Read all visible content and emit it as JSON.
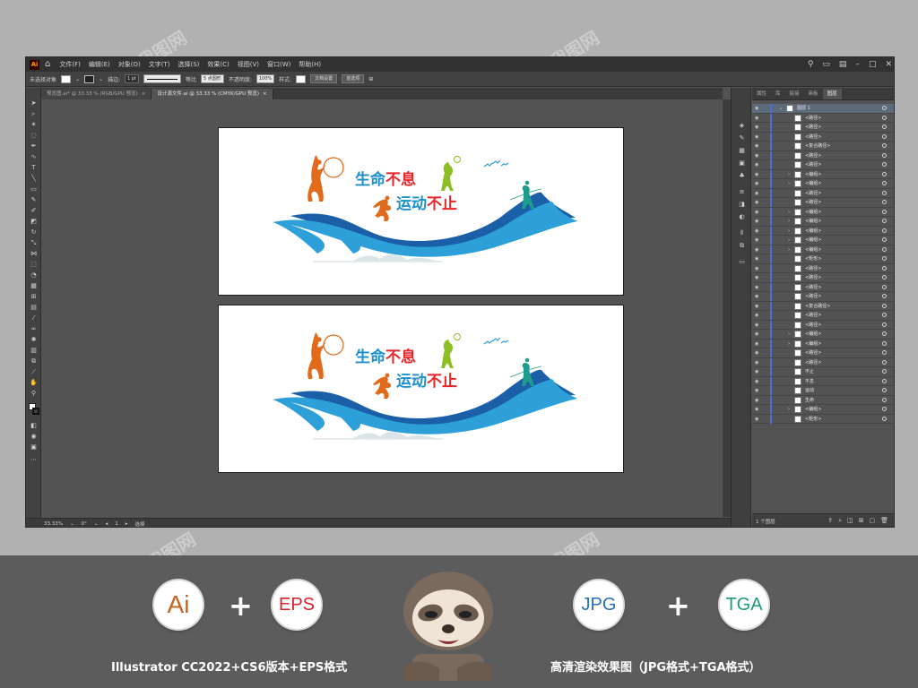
{
  "menubar": {
    "app_icon": "Ai",
    "items": [
      "文件(F)",
      "编辑(E)",
      "对象(O)",
      "文字(T)",
      "选择(S)",
      "效果(C)",
      "视图(V)",
      "窗口(W)",
      "帮助(H)"
    ]
  },
  "control_bar": {
    "selection_label": "未选择对象",
    "stroke_label": "描边:",
    "stroke_weight": "1 pt",
    "stroke_profile": "等比",
    "brush": "5 点圆形",
    "opacity_label": "不透明度:",
    "opacity_value": "100%",
    "style_label": "样式:",
    "doc_setup_button": "文档设置",
    "preferences_button": "首选项"
  },
  "doc_tabs": [
    {
      "label": "预览图.ai* @ 33.33 % (RGB/GPU 预览)",
      "active": false
    },
    {
      "label": "设计源文件.ai @ 33.33 % (CMYK/GPU 预览)",
      "active": true
    }
  ],
  "status_bar": {
    "zoom": "33.33%",
    "rotation": "0°",
    "artboard_number": "1",
    "mode": "选择"
  },
  "artwork": {
    "line1_a": "生命",
    "line1_b": "不息",
    "line2_a": "运动",
    "line2_b": "不止"
  },
  "layers_panel": {
    "tabs": [
      "属性",
      "库",
      "链接",
      "画板",
      "图层"
    ],
    "active_tab": "图层",
    "top_layer": "图层 1",
    "items": [
      "<路径>",
      "<路径>",
      "<路径>",
      "<复合路径>",
      "<路径>",
      "<路径>",
      "<编组>",
      "<编组>",
      "<路径>",
      "<路径>",
      "<编组>",
      "<编组>",
      "<编组>",
      "<编组>",
      "<编组>",
      "<矩形>",
      "<路径>",
      "<路径>",
      "<路径>",
      "<路径>",
      "<复合路径>",
      "<路径>",
      "<路径>",
      "<编组>",
      "<编组>",
      "<路径>",
      "<路径>",
      "不止",
      "不息",
      "运动",
      "生命",
      "<编组>",
      "<矩形>"
    ],
    "footer_count": "1 个图层"
  },
  "watermark_text": "我图网",
  "banner": {
    "badges": [
      {
        "label": "Ai",
        "color": "#c8641e"
      },
      {
        "label": "EPS",
        "color": "#d8232a"
      },
      {
        "label": "JPG",
        "color": "#2a6fb8"
      },
      {
        "label": "TGA",
        "color": "#1c9b7a"
      }
    ],
    "plus": "+",
    "caption_left": "Illustrator CC2022+CS6版本+EPS格式",
    "caption_right": "高清渲染效果图（JPG格式+TGA格式）"
  },
  "colors": {
    "wave_blue": "#2d9fd9",
    "wave_dark": "#1a5fa8",
    "text_blue": "#1e8fc9",
    "text_red": "#e8262a",
    "runner_orange": "#e26a1b",
    "runner_green": "#8cbf26",
    "runner_teal": "#1e9c8c"
  }
}
